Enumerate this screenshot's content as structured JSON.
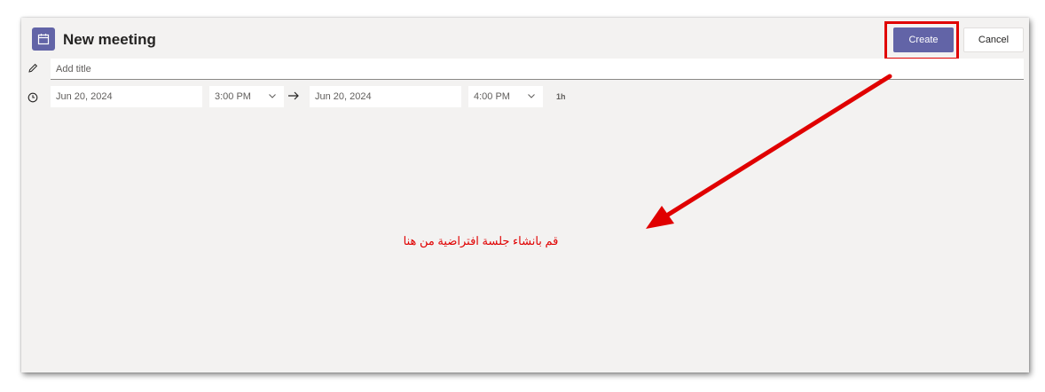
{
  "header": {
    "title": "New meeting",
    "icon": "calendar-icon",
    "create_label": "Create",
    "cancel_label": "Cancel"
  },
  "title_field": {
    "placeholder": "Add title",
    "icon": "pencil-icon"
  },
  "schedule": {
    "icon": "clock-icon",
    "start_date": "Jun 20, 2024",
    "start_time": "3:00 PM",
    "end_date": "Jun 20, 2024",
    "end_time": "4:00 PM",
    "duration": "1h",
    "separator_icon": "arrow-right-icon"
  },
  "annotation": {
    "text": "قم بانشاء جلسة افتراضية من هنا",
    "color": "#e00000"
  },
  "colors": {
    "accent": "#6264a7",
    "annotation": "#e00000",
    "canvas": "#f3f2f1"
  }
}
